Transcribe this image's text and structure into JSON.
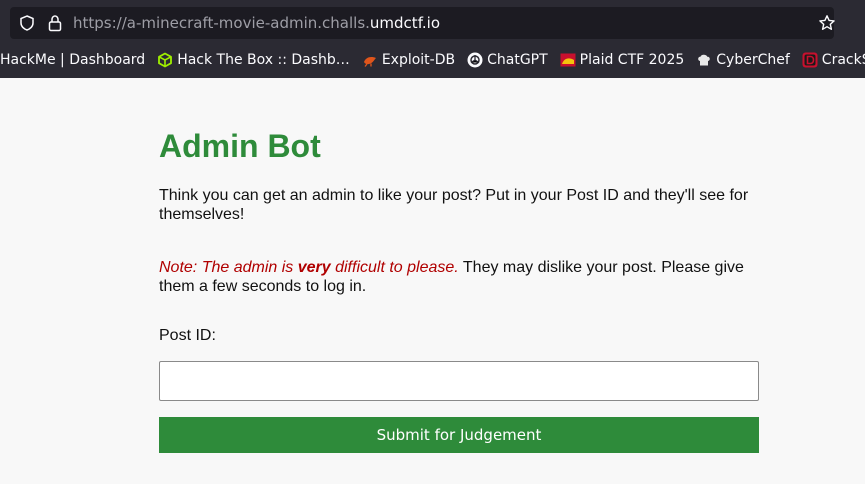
{
  "browser": {
    "url_prefix": "https://a-minecraft-movie-admin.challs.",
    "url_domain": "umdctf.io",
    "bookmarks": [
      {
        "label": "HackMe | Dashboard",
        "icon": "none"
      },
      {
        "label": "Hack The Box :: Dashb…",
        "icon": "htb-cube-icon"
      },
      {
        "label": "Exploit-DB",
        "icon": "exploit-db-icon"
      },
      {
        "label": "ChatGPT",
        "icon": "chatgpt-icon"
      },
      {
        "label": "Plaid CTF 2025",
        "icon": "plaid-ctf-icon"
      },
      {
        "label": "CyberChef",
        "icon": "cyberchef-icon"
      },
      {
        "label": "CrackStation",
        "icon": "crackstation-icon"
      }
    ]
  },
  "page": {
    "title": "Admin Bot",
    "intro": "Think you can get an admin to like your post? Put in your Post ID and they'll see for themselves!",
    "note_prefix": "Note: The admin is ",
    "note_emph": "very",
    "note_suffix": " difficult to please.",
    "note_rest": " They may dislike your post. Please give them a few seconds to log in.",
    "post_id_label": "Post ID:",
    "post_id_value": "",
    "submit_label": "Submit for Judgement"
  },
  "colors": {
    "accent": "#2e8b3a",
    "note_red": "#b00000",
    "chrome_bg": "#2b2a33"
  }
}
